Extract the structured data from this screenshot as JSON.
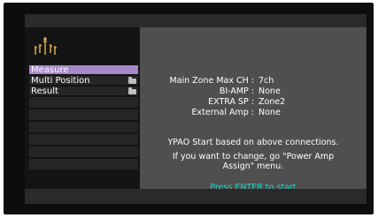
{
  "menu": {
    "items": [
      {
        "label": "Measure",
        "selected": true,
        "has_folder": false
      },
      {
        "label": "Multi Position",
        "selected": false,
        "has_folder": true
      },
      {
        "label": "Result",
        "selected": false,
        "has_folder": true
      }
    ]
  },
  "info": {
    "rows": [
      {
        "key": "Main Zone Max CH :",
        "value": "7ch"
      },
      {
        "key": "BI-AMP :",
        "value": "None"
      },
      {
        "key": "EXTRA SP :",
        "value": "Zone2"
      },
      {
        "key": "External Amp :",
        "value": "None"
      }
    ]
  },
  "message": {
    "line1": "YPAO Start based on above connections.",
    "line2": "If you want to change, go \"Power Amp",
    "line3": "Assign\" menu."
  },
  "prompt": "Press ENTER to start",
  "colors": {
    "selected_bg": "#a689c9",
    "prompt_text": "#1fd3c8",
    "screen_bg": "#4f4f4f",
    "sidebar_bg": "#141414"
  },
  "icons": {
    "logo": "ypao-logo-icon",
    "folder": "folder-icon"
  }
}
